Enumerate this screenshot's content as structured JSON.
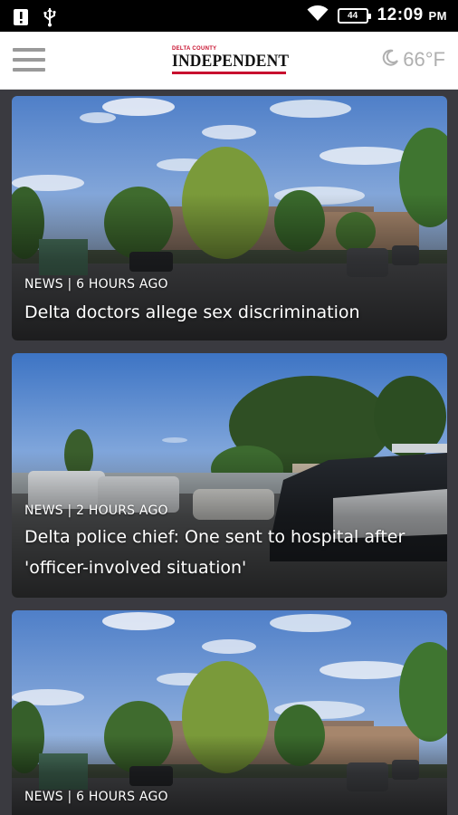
{
  "status_bar": {
    "time": "12:09",
    "ampm": "PM",
    "battery": "44",
    "icons": [
      "notification-icon",
      "usb-icon",
      "wifi-icon",
      "battery-icon"
    ]
  },
  "header": {
    "logo_top": "DELTA COUNTY",
    "logo_name": "INDEPENDENT",
    "temperature": "66°F",
    "weather_icon": "moon-icon",
    "menu_icon": "hamburger-menu-icon"
  },
  "colors": {
    "brand_red": "#c8102e",
    "background": "#3a3a40",
    "header_bg": "#ffffff"
  },
  "articles": [
    {
      "category": "NEWS",
      "separator": "|",
      "time": "6 HOURS AGO",
      "headline": "Delta doctors allege sex discrimination"
    },
    {
      "category": "NEWS",
      "separator": "|",
      "time": "2 HOURS AGO",
      "headline": "Delta police chief: One sent to hospital after 'officer-involved situation'"
    },
    {
      "category": "NEWS",
      "separator": "|",
      "time": "6 HOURS AGO",
      "headline": ""
    }
  ]
}
